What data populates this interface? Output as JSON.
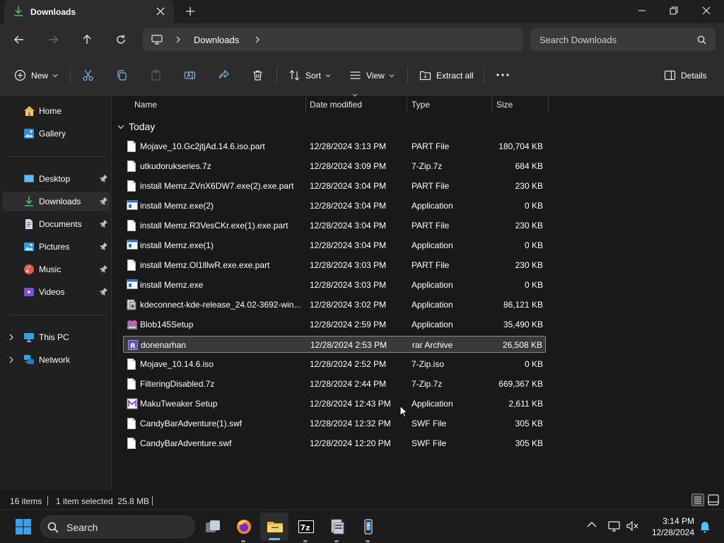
{
  "window": {
    "tab_title": "Downloads",
    "colors": {
      "accent": "#4cc2ff",
      "background": "#191919",
      "chrome": "#2c2c2c"
    }
  },
  "address": {
    "crumb": "Downloads",
    "search_placeholder": "Search Downloads"
  },
  "commands": {
    "new": "New",
    "sort": "Sort",
    "view": "View",
    "extract_all": "Extract all",
    "details": "Details"
  },
  "sidebar": {
    "home": "Home",
    "gallery": "Gallery",
    "desktop": "Desktop",
    "downloads": "Downloads",
    "documents": "Documents",
    "pictures": "Pictures",
    "music": "Music",
    "videos": "Videos",
    "this_pc": "This PC",
    "network": "Network"
  },
  "columns": {
    "name": "Name",
    "date": "Date modified",
    "type": "Type",
    "size": "Size"
  },
  "group_label": "Today",
  "files": [
    {
      "name": "Mojave_10.Gc2jtjAd.14.6.iso.part",
      "date": "12/28/2024 3:13 PM",
      "type": "PART File",
      "size": "180,704 KB",
      "icon": "blank-file-icon"
    },
    {
      "name": "utkudorukseries.7z",
      "date": "12/28/2024 3:09 PM",
      "type": "7-Zip.7z",
      "size": "684 KB",
      "icon": "blank-file-icon"
    },
    {
      "name": "install Memz.ZVnX6DW7.exe(2).exe.part",
      "date": "12/28/2024 3:04 PM",
      "type": "PART File",
      "size": "230 KB",
      "icon": "blank-file-icon"
    },
    {
      "name": "install Memz.exe(2)",
      "date": "12/28/2024 3:04 PM",
      "type": "Application",
      "size": "0 KB",
      "icon": "application-icon"
    },
    {
      "name": "install Memz.R3VesCKr.exe(1).exe.part",
      "date": "12/28/2024 3:04 PM",
      "type": "PART File",
      "size": "230 KB",
      "icon": "blank-file-icon"
    },
    {
      "name": "install Memz.exe(1)",
      "date": "12/28/2024 3:04 PM",
      "type": "Application",
      "size": "0 KB",
      "icon": "application-icon"
    },
    {
      "name": "install Memz.Ol1lllwR.exe.exe.part",
      "date": "12/28/2024 3:03 PM",
      "type": "PART File",
      "size": "230 KB",
      "icon": "blank-file-icon"
    },
    {
      "name": "install Memz.exe",
      "date": "12/28/2024 3:03 PM",
      "type": "Application",
      "size": "0 KB",
      "icon": "application-icon"
    },
    {
      "name": "kdeconnect-kde-release_24.02-3692-win...",
      "date": "12/28/2024 3:02 PM",
      "type": "Application",
      "size": "86,121 KB",
      "icon": "installer-icon"
    },
    {
      "name": "Blob145Setup",
      "date": "12/28/2024 2:59 PM",
      "type": "Application",
      "size": "35,490 KB",
      "icon": "setup-icon"
    },
    {
      "name": "donenarhan",
      "date": "12/28/2024 2:53 PM",
      "type": "rar Archive",
      "size": "26,508 KB",
      "icon": "rar-archive-icon"
    },
    {
      "name": "Mojave_10.14.6.iso",
      "date": "12/28/2024 2:52 PM",
      "type": "7-Zip.iso",
      "size": "0 KB",
      "icon": "blank-file-icon"
    },
    {
      "name": "FilteringDisabled.7z",
      "date": "12/28/2024 2:44 PM",
      "type": "7-Zip.7z",
      "size": "669,367 KB",
      "icon": "blank-file-icon"
    },
    {
      "name": "MakuTweaker Setup",
      "date": "12/28/2024 12:43 PM",
      "type": "Application",
      "size": "2,611 KB",
      "icon": "maku-setup-icon"
    },
    {
      "name": "CandyBarAdventure(1).swf",
      "date": "12/28/2024 12:32 PM",
      "type": "SWF File",
      "size": "305 KB",
      "icon": "blank-file-icon"
    },
    {
      "name": "CandyBarAdventure.swf",
      "date": "12/28/2024 12:20 PM",
      "type": "SWF File",
      "size": "305 KB",
      "icon": "blank-file-icon"
    }
  ],
  "selected_index": 10,
  "status": {
    "count": "16 items",
    "selection": "1 item selected  25.8 MB"
  },
  "taskbar": {
    "search_label": "Search",
    "time": "3:14 PM",
    "date": "12/28/2024",
    "apps": [
      "task-view-icon",
      "firefox-icon",
      "file-explorer-icon",
      "7zip-icon",
      "installer-app-icon",
      "phone-link-icon"
    ]
  }
}
